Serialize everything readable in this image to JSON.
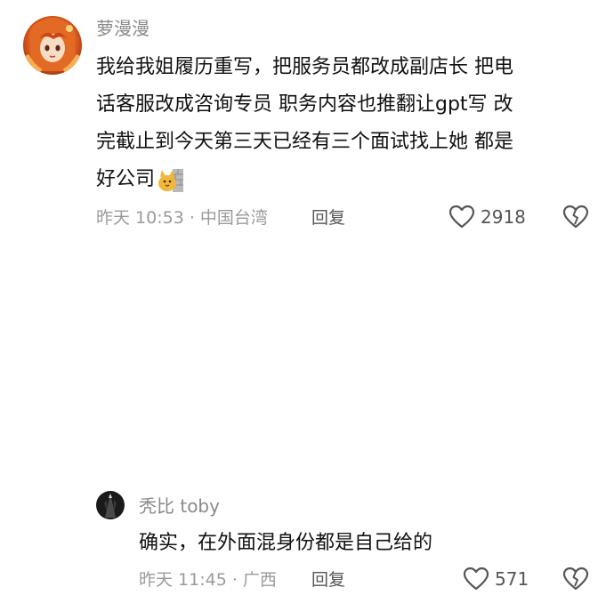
{
  "comments": [
    {
      "username": "萝漫漫",
      "avatar_icon": "anime-avatar-icon",
      "text_lines": [
        "我给我姐履历重写，把服务员都改成副店长 把电",
        "话客服改成咨询专员 职务内容也推翻让gpt写 改",
        "完截止到今天第三天已经有三个面试找上她 都是",
        "好公司"
      ],
      "emoji_icon": "cat-on-wall-emoji",
      "meta": "昨天 10:53 · 中国台湾",
      "reply_label": "回复",
      "like_count": "2918"
    },
    {
      "username": "秃比 toby",
      "avatar_icon": "dark-avatar-icon",
      "text_lines": [
        "确实，在外面混身份都是自己给的"
      ],
      "meta": "昨天 11:45 · 广西",
      "reply_label": "回复",
      "like_count": "571"
    }
  ],
  "colors": {
    "username": "#8a8a8a",
    "text": "#111111",
    "meta": "#9a9a9a",
    "icon": "#555555"
  }
}
